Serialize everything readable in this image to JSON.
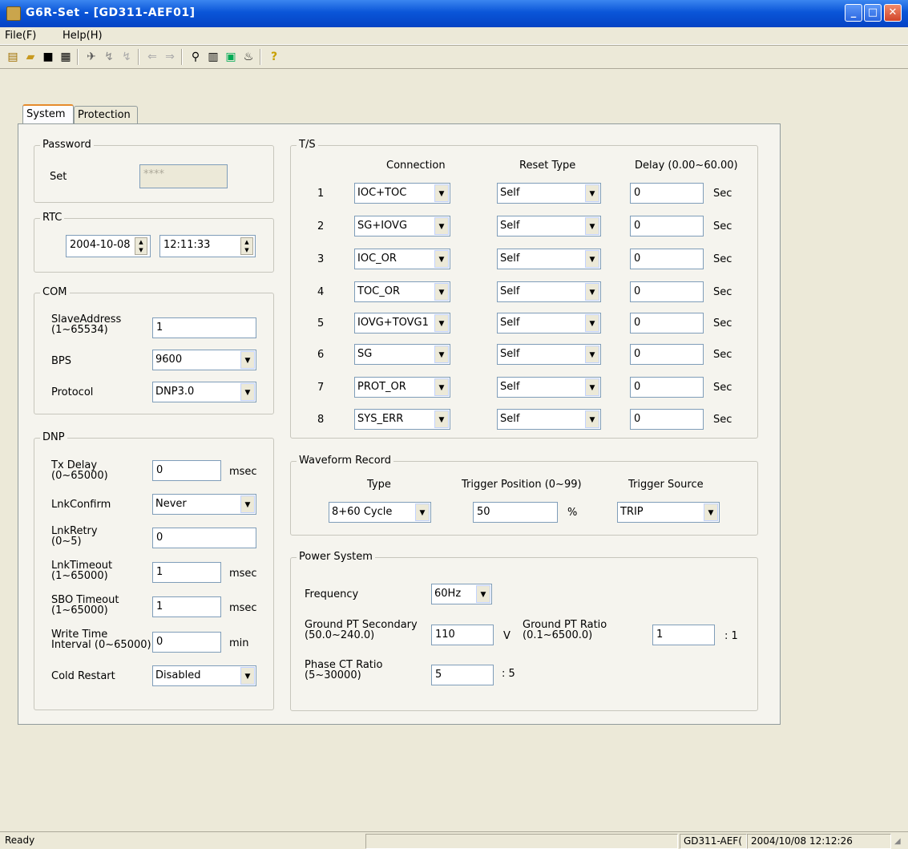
{
  "window": {
    "title": "G6R-Set - [GD311-AEF01]"
  },
  "menu": [
    "File(F)",
    "Help(H)"
  ],
  "toolbar_icons": [
    "new-icon",
    "open-icon",
    "save-icon",
    "print-icon",
    "connect-icon",
    "read-icon",
    "write-icon",
    "download-icon",
    "upload-icon",
    "search-icon",
    "calculator-icon",
    "monitor-icon",
    "event-icon",
    "help-icon"
  ],
  "tabs": [
    "System",
    "Protection"
  ],
  "password": {
    "legend": "Password",
    "label": "Set",
    "value": "****"
  },
  "rtc": {
    "legend": "RTC",
    "date": "2004-10-08",
    "time": "12:11:33"
  },
  "com": {
    "legend": "COM",
    "slave_label": "SlaveAddress",
    "slave_range": "(1~65534)",
    "slave_value": "1",
    "bps_label": "BPS",
    "bps_value": "9600",
    "protocol_label": "Protocol",
    "protocol_value": "DNP3.0"
  },
  "dnp": {
    "legend": "DNP",
    "tx_delay_label": "Tx Delay",
    "tx_delay_range": "(0~65000)",
    "tx_delay_value": "0",
    "tx_delay_unit": "msec",
    "lnk_confirm_label": "LnkConfirm",
    "lnk_confirm_value": "Never",
    "lnk_retry_label": "LnkRetry",
    "lnk_retry_range": "(0~5)",
    "lnk_retry_value": "0",
    "lnk_timeout_label": "LnkTimeout",
    "lnk_timeout_range": "(1~65000)",
    "lnk_timeout_value": "1",
    "lnk_timeout_unit": "msec",
    "sbo_label": "SBO Timeout",
    "sbo_range": "(1~65000)",
    "sbo_value": "1",
    "sbo_unit": "msec",
    "write_label": "Write Time",
    "write_range": "Interval (0~65000)",
    "write_value": "0",
    "write_unit": "min",
    "cold_label": "Cold Restart",
    "cold_value": "Disabled"
  },
  "ts": {
    "legend": "T/S",
    "col_connection": "Connection",
    "col_reset": "Reset Type",
    "col_delay": "Delay (0.00~60.00)",
    "unit": "Sec",
    "rows": [
      {
        "num": "1",
        "connection": "IOC+TOC",
        "reset": "Self",
        "delay": "0"
      },
      {
        "num": "2",
        "connection": "SG+IOVG",
        "reset": "Self",
        "delay": "0"
      },
      {
        "num": "3",
        "connection": "IOC_OR",
        "reset": "Self",
        "delay": "0"
      },
      {
        "num": "4",
        "connection": "TOC_OR",
        "reset": "Self",
        "delay": "0"
      },
      {
        "num": "5",
        "connection": "IOVG+TOVG1",
        "reset": "Self",
        "delay": "0"
      },
      {
        "num": "6",
        "connection": "SG",
        "reset": "Self",
        "delay": "0"
      },
      {
        "num": "7",
        "connection": "PROT_OR",
        "reset": "Self",
        "delay": "0"
      },
      {
        "num": "8",
        "connection": "SYS_ERR",
        "reset": "Self",
        "delay": "0"
      }
    ]
  },
  "waveform": {
    "legend": "Waveform Record",
    "type_label": "Type",
    "type_value": "8+60  Cycle",
    "trigger_pos_label": "Trigger Position (0~99)",
    "trigger_pos_value": "50",
    "trigger_pos_unit": "%",
    "trigger_src_label": "Trigger Source",
    "trigger_src_value": "TRIP"
  },
  "power": {
    "legend": "Power System",
    "freq_label": "Frequency",
    "freq_value": "60Hz",
    "gpt_sec_label": "Ground PT Secondary",
    "gpt_sec_range": "(50.0~240.0)",
    "gpt_sec_value": "110",
    "gpt_sec_unit": "V",
    "gpt_ratio_label": "Ground PT Ratio",
    "gpt_ratio_range": "(0.1~6500.0)",
    "gpt_ratio_value": "1",
    "gpt_ratio_unit": ": 1",
    "ct_label": "Phase CT Ratio",
    "ct_range": "(5~30000)",
    "ct_value": "5",
    "ct_unit": ": 5"
  },
  "status": {
    "left": "Ready",
    "device": "GD311-AEF(",
    "datetime": "2004/10/08 12:12:26"
  }
}
